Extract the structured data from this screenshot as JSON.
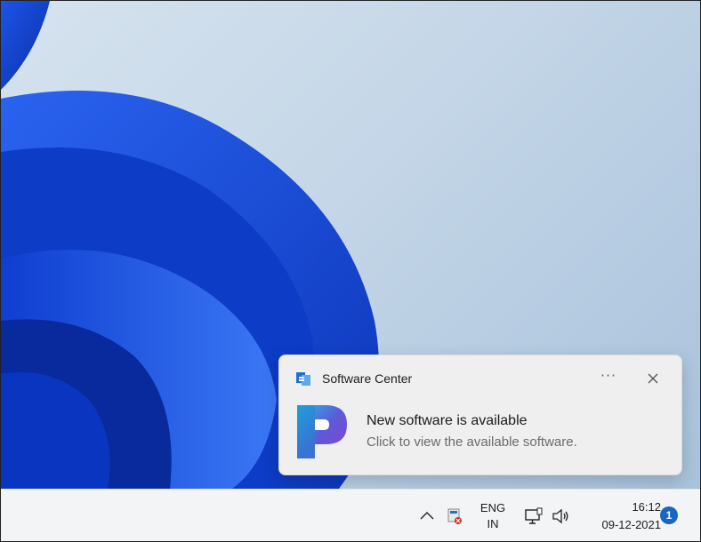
{
  "notification": {
    "app_name": "Software Center",
    "title": "New software is available",
    "body": "Click to view the available software.",
    "more_label": "···",
    "app_icon": "software-center-icon",
    "hero_icon": "software-center-logo",
    "close_icon": "close-icon"
  },
  "taskbar": {
    "language_line1": "ENG",
    "language_line2": "IN",
    "time": "16:12",
    "date": "09-12-2021",
    "notification_count": "1",
    "icons": [
      "chevron-up-icon",
      "software-center-tray-icon",
      "network-icon",
      "volume-icon"
    ]
  },
  "colors": {
    "accent": "#1766c4",
    "toast_bg": "#efefef",
    "taskbar_bg": "#f3f4f6",
    "wallpaper_blue": "#0b3fd3"
  }
}
